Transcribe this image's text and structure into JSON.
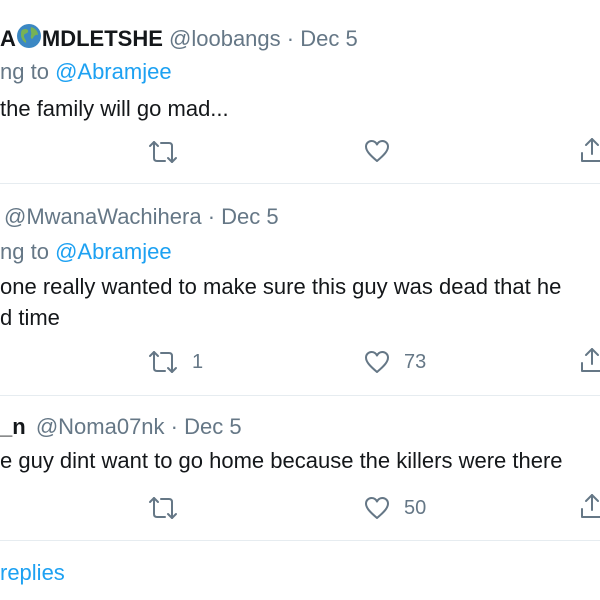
{
  "tweets": [
    {
      "display_name_start": "A",
      "display_name_end": "MDLETSHE",
      "handle": "@loobangs",
      "separator": "·",
      "date": "Dec 5",
      "replying_prefix": "ng to",
      "replying_handle": "@Abramjee",
      "text_lines": [
        "the family will go mad..."
      ],
      "reply_count": "",
      "like_count": ""
    },
    {
      "display_name": "",
      "handle": "@MwanaWachihera",
      "separator": "·",
      "date": "Dec 5",
      "replying_prefix": "ng to",
      "replying_handle": "@Abramjee",
      "text_lines": [
        "one really wanted to make sure this guy was dead that he",
        "d time"
      ],
      "retweet_count": "1",
      "like_count": "73"
    },
    {
      "display_name": "_n",
      "handle": "@Noma07nk",
      "separator": "·",
      "date": "Dec 5",
      "text_lines": [
        "e guy dint want to go home because the killers were there"
      ],
      "retweet_count": "",
      "like_count": "50"
    }
  ],
  "show_replies_label": "replies",
  "colors": {
    "link": "#1da1f2",
    "muted": "#657786",
    "text": "#14171a",
    "divider": "#e6ecf0"
  },
  "icons": [
    "globe-icon",
    "retweet-icon",
    "like-icon",
    "share-icon"
  ]
}
